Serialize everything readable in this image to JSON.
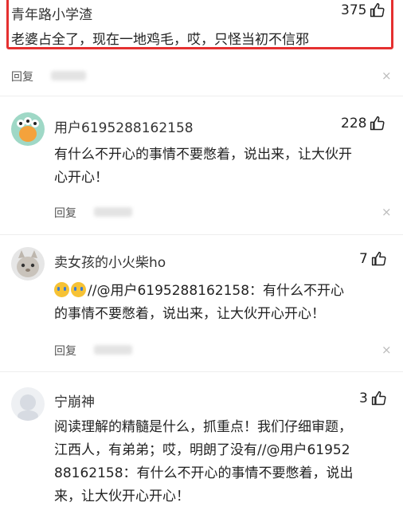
{
  "top_comment": {
    "username": "青年路小学渣",
    "likes": "375",
    "text": "老婆占全了，现在一地鸡毛，哎，只怪当初不信邪",
    "reply_label": "回复",
    "close": "×"
  },
  "comments": [
    {
      "username": "用户6195288162158",
      "likes": "228",
      "lines": [
        "有什么不开心的事情不要憋着，说出来，让大伙开",
        "心开心！"
      ],
      "reply_label": "回复",
      "close": "×"
    },
    {
      "username": "卖女孩的小火柴ho",
      "likes": "7",
      "lines": [
        "//@用户6195288162158：有什么不开心",
        "的事情不要憋着，说出来，让大伙开心开心！"
      ],
      "reply_label": "回复",
      "close": "×"
    },
    {
      "username": "宁崩神",
      "likes": "3",
      "lines": [
        "阅读理解的精髓是什么，抓重点！我们仔细审题，",
        "江西人，有弟弟；哎，明朗了没有//@用户61952",
        "88162158：有什么不开心的事情不要憋着，说出",
        "来，让大伙开心开心！"
      ]
    }
  ]
}
